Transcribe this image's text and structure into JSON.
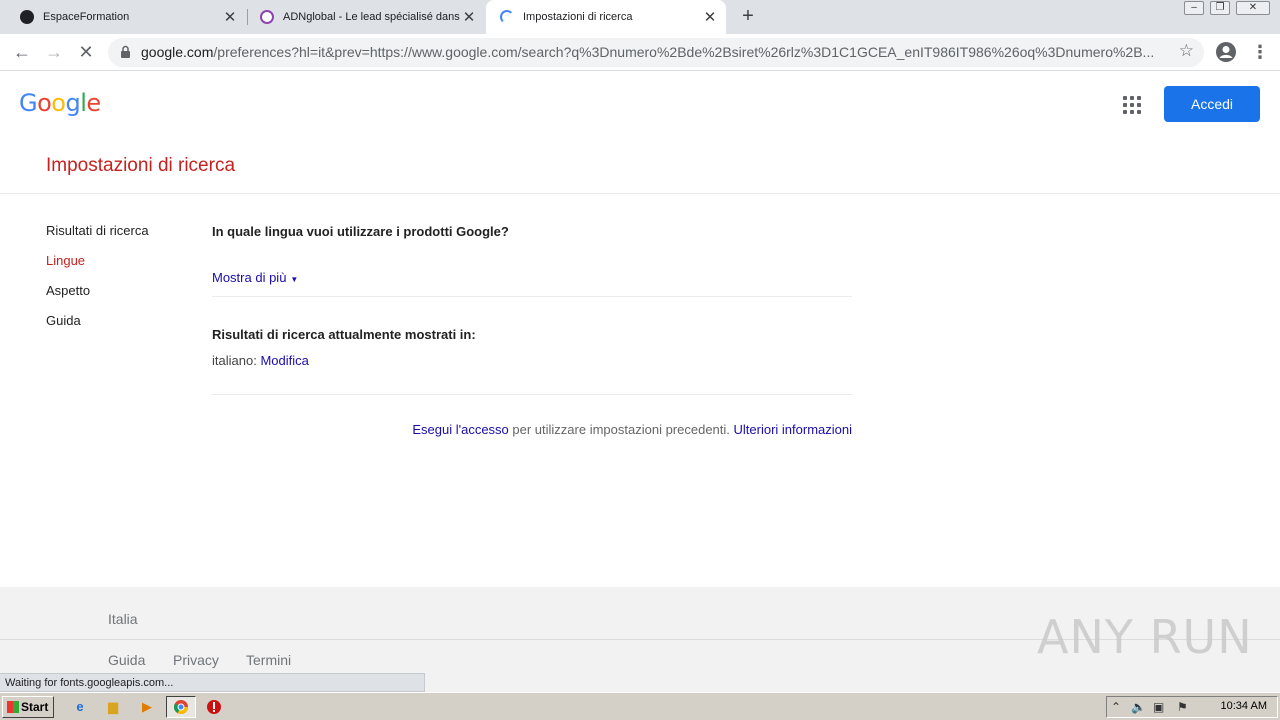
{
  "browser": {
    "tabs": [
      {
        "title": "EspaceFormation",
        "favicon_color": "#202124"
      },
      {
        "title": "ADNglobal - Le lead spécialisé dans l'é",
        "favicon_color": "#8e44ad"
      },
      {
        "title": "Impostazioni di ricerca",
        "favicon_color": "#4285f4"
      }
    ],
    "url_host": "google.com",
    "url_path": "/preferences?hl=it&prev=https://www.google.com/search?q%3Dnumero%2Bde%2Bsiret%26rlz%3D1C1GCEA_enIT986IT986%26oq%3Dnumero%2B...",
    "status_text": "Waiting for fonts.googleapis.com..."
  },
  "google": {
    "logo_letters": [
      "G",
      "o",
      "o",
      "g",
      "l",
      "e"
    ],
    "logo_colors": [
      "#4285f4",
      "#ea4335",
      "#fbbc05",
      "#4285f4",
      "#34a853",
      "#ea4335"
    ],
    "signin_label": "Accedi",
    "page_title": "Impostazioni di ricerca",
    "nav": [
      "Risultati di ricerca",
      "Lingue",
      "Aspetto",
      "Guida"
    ],
    "selected_nav": "Lingue",
    "lang_question": "In quale lingua vuoi utilizzare i prodotti Google?",
    "show_more": "Mostra di più",
    "results_heading": "Risultati di ricerca attualmente mostrati in:",
    "current_language": "italiano",
    "edit_link": "Modifica",
    "signin_note_link": "Esegui l'accesso",
    "signin_note_text": " per utilizzare impostazioni precedenti. ",
    "more_info_link": "Ulteriori informazioni"
  },
  "footer": {
    "country": "Italia",
    "links": [
      "Guida",
      "Privacy",
      "Termini"
    ]
  },
  "watermark": "ANY RUN",
  "taskbar": {
    "start_label": "Start",
    "clock": "10:34 AM"
  },
  "colors": {
    "accent_red": "#c5221f",
    "link_blue": "#1a0dab",
    "button_blue": "#1a73e8"
  }
}
